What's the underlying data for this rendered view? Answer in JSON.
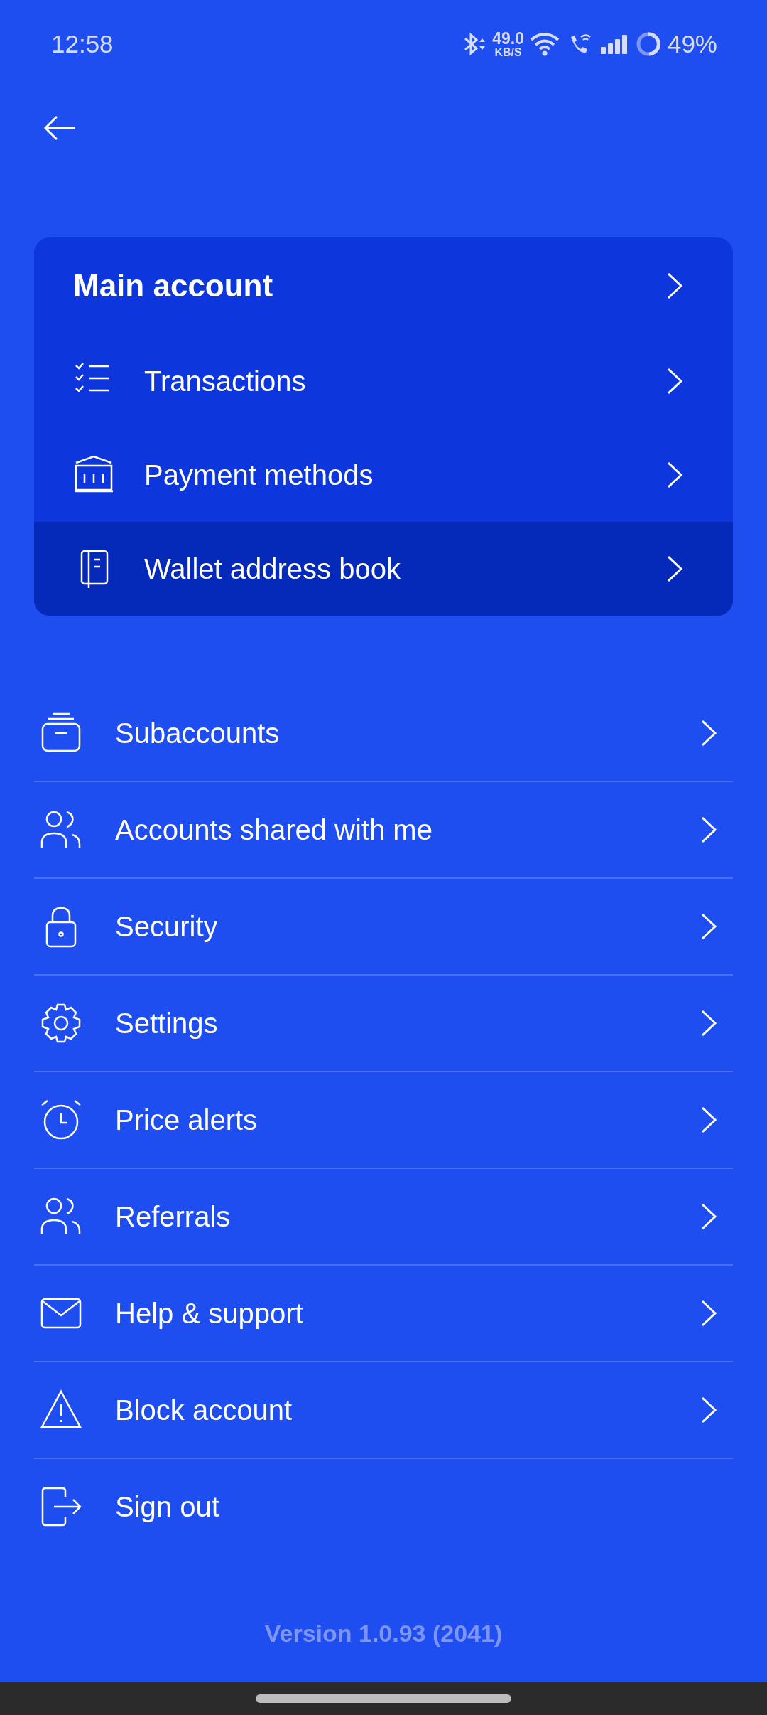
{
  "status_bar": {
    "time": "12:58",
    "speed": "49.0",
    "speed_unit": "KB/S",
    "battery": "49%"
  },
  "account_card": {
    "title": "Main account",
    "items": [
      {
        "label": "Transactions",
        "selected": false
      },
      {
        "label": "Payment methods",
        "selected": false
      },
      {
        "label": "Wallet address book",
        "selected": true
      }
    ]
  },
  "menu": [
    {
      "label": "Subaccounts",
      "chevron": true
    },
    {
      "label": "Accounts shared with me",
      "chevron": true
    },
    {
      "label": "Security",
      "chevron": true
    },
    {
      "label": "Settings",
      "chevron": true
    },
    {
      "label": "Price alerts",
      "chevron": true
    },
    {
      "label": "Referrals",
      "chevron": true
    },
    {
      "label": "Help & support",
      "chevron": true
    },
    {
      "label": "Block account",
      "chevron": true
    },
    {
      "label": "Sign out",
      "chevron": false
    }
  ],
  "version": "Version 1.0.93 (2041)"
}
